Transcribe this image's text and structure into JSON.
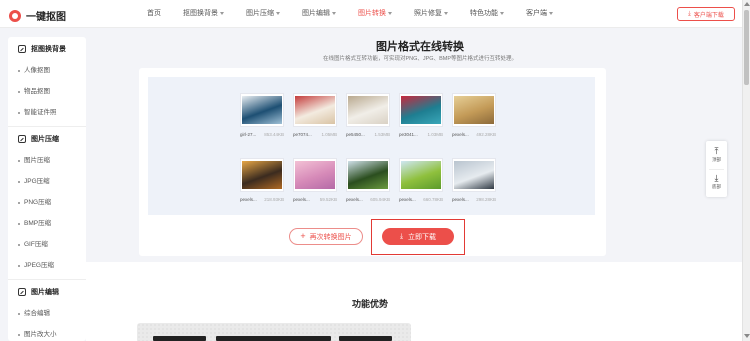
{
  "brand": {
    "name": "一键抠图"
  },
  "nav": [
    {
      "label": "首页",
      "caret": false,
      "active": false
    },
    {
      "label": "抠图换背景",
      "caret": true,
      "active": false
    },
    {
      "label": "图片压缩",
      "caret": true,
      "active": false
    },
    {
      "label": "图片编辑",
      "caret": true,
      "active": false
    },
    {
      "label": "图片转换",
      "caret": true,
      "active": true
    },
    {
      "label": "照片修复",
      "caret": true,
      "active": false
    },
    {
      "label": "特色功能",
      "caret": true,
      "active": false
    },
    {
      "label": "客户端",
      "caret": true,
      "active": false
    }
  ],
  "header_button": {
    "label": "客户端下载"
  },
  "sidebar": {
    "groups": [
      {
        "title": "抠图换背景",
        "items": [
          "人像抠图",
          "物品抠图",
          "智能证件照"
        ]
      },
      {
        "title": "图片压缩",
        "items": [
          "图片压缩",
          "JPG压缩",
          "PNG压缩",
          "BMP压缩",
          "GIF压缩",
          "JPEG压缩"
        ]
      },
      {
        "title": "图片编辑",
        "items": [
          "综合编辑",
          "图片改大小"
        ]
      }
    ]
  },
  "main": {
    "title": "图片格式在线转换",
    "subtitle": "在线图片格式互转功能，可实现对PNG、JPG、BMP等图片格式进行互转处理。",
    "again_button": "再次转换图片",
    "download_button": "立即下载"
  },
  "images": [
    {
      "name": "girl-27...",
      "size": "853.44KB",
      "colors": [
        "#1d4f73",
        "#9fc0d6",
        "#e9eef2"
      ]
    },
    {
      "name": "pe7074...",
      "size": "1.05MB",
      "colors": [
        "#f3ebe0",
        "#d9c3a4",
        "#c43c3c"
      ]
    },
    {
      "name": "pe5450...",
      "size": "1.53MB",
      "colors": [
        "#f1eee8",
        "#d9d1c4",
        "#b9a98f"
      ]
    },
    {
      "name": "pe3041...",
      "size": "1.03MB",
      "colors": [
        "#1e7e91",
        "#3aa7b9",
        "#c8283d"
      ]
    },
    {
      "name": "pexels...",
      "size": "492.28KB",
      "colors": [
        "#c39a57",
        "#8c6a3a",
        "#e6cf97"
      ]
    },
    {
      "name": "pexels...",
      "size": "218.93KB",
      "colors": [
        "#3b2b1f",
        "#b06a24",
        "#e7a646"
      ]
    },
    {
      "name": "pexels...",
      "size": "59.52KB",
      "colors": [
        "#d68ab8",
        "#b46aa7",
        "#f3c1d5"
      ]
    },
    {
      "name": "pexels...",
      "size": "605.94KB",
      "colors": [
        "#2b4e1f",
        "#6b9b3e",
        "#cfe0e8"
      ]
    },
    {
      "name": "pexels...",
      "size": "660.78KB",
      "colors": [
        "#8fc03d",
        "#5c9b2c",
        "#cfe7f3"
      ]
    },
    {
      "name": "pexels...",
      "size": "298.28KB",
      "colors": [
        "#e6ebef",
        "#2f3944",
        "#b9c4cf"
      ]
    }
  ],
  "features": {
    "title": "功能优势"
  },
  "tools": {
    "top": "顶部",
    "down": "底部"
  }
}
